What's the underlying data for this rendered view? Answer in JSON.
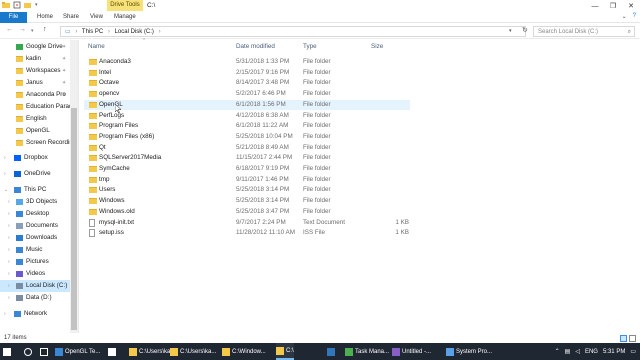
{
  "window": {
    "context_tab": "Drive Tools",
    "title": "C:\\",
    "controls": [
      "—",
      "❐",
      "✕"
    ]
  },
  "ribbon": {
    "tabs": [
      "File",
      "Home",
      "Share",
      "View",
      "Manage"
    ]
  },
  "address": {
    "crumbs": [
      "This PC",
      "›",
      "Local Disk (C:)",
      "›"
    ],
    "search_placeholder": "Search Local Disk (C:)"
  },
  "nav": {
    "items": [
      {
        "label": "Google Drive",
        "icon": "google-drive-icon",
        "pinned": true,
        "color": "#34a853"
      },
      {
        "label": "kadin",
        "icon": "folder-icon",
        "pinned": true,
        "color": "#f4c94b"
      },
      {
        "label": "Workspaces",
        "icon": "folder-icon",
        "pinned": true,
        "color": "#f4c94b"
      },
      {
        "label": "Janus",
        "icon": "folder-icon",
        "pinned": true,
        "color": "#f4c94b"
      },
      {
        "label": "Anaconda Pro",
        "icon": "folder-icon",
        "pinned": true,
        "color": "#f4c94b"
      },
      {
        "label": "Education Paradi",
        "icon": "folder-icon",
        "pinned": false,
        "color": "#f4c94b"
      },
      {
        "label": "English",
        "icon": "folder-icon",
        "pinned": false,
        "color": "#f4c94b"
      },
      {
        "label": "OpenGL",
        "icon": "folder-icon",
        "pinned": false,
        "color": "#f4c94b"
      },
      {
        "label": "Screen Recording",
        "icon": "folder-icon",
        "pinned": false,
        "color": "#f4c94b"
      },
      {
        "label": "Dropbox",
        "icon": "dropbox-icon",
        "pinned": false,
        "color": "#0061ff"
      },
      {
        "label": "OneDrive",
        "icon": "onedrive-icon",
        "pinned": false,
        "color": "#0a64d6"
      },
      {
        "label": "This PC",
        "icon": "pc-icon",
        "pinned": false,
        "color": "#3a87d8"
      },
      {
        "label": "3D Objects",
        "icon": "3d-objects-icon",
        "pinned": false,
        "color": "#56a8e8"
      },
      {
        "label": "Desktop",
        "icon": "desktop-icon",
        "pinned": false,
        "color": "#3a87d8"
      },
      {
        "label": "Documents",
        "icon": "documents-icon",
        "pinned": false,
        "color": "#8aa0b8"
      },
      {
        "label": "Downloads",
        "icon": "downloads-icon",
        "pinned": false,
        "color": "#2b7cd3"
      },
      {
        "label": "Music",
        "icon": "music-icon",
        "pinned": false,
        "color": "#3a87d8"
      },
      {
        "label": "Pictures",
        "icon": "pictures-icon",
        "pinned": false,
        "color": "#3a87d8"
      },
      {
        "label": "Videos",
        "icon": "videos-icon",
        "pinned": false,
        "color": "#6a5acd"
      },
      {
        "label": "Local Disk (C:)",
        "icon": "drive-icon",
        "pinned": false,
        "color": "#7a8da3"
      },
      {
        "label": "Data (D:)",
        "icon": "drive-icon",
        "pinned": false,
        "color": "#7a8da3"
      },
      {
        "label": "Network",
        "icon": "network-icon",
        "pinned": false,
        "color": "#3a87d8"
      }
    ]
  },
  "columns": {
    "name": "Name",
    "date": "Date modified",
    "type": "Type",
    "size": "Size"
  },
  "files": [
    {
      "name": "Anaconda3",
      "date": "5/31/2018 1:33 PM",
      "type": "File folder",
      "size": ""
    },
    {
      "name": "Intel",
      "date": "2/15/2017 9:16 PM",
      "type": "File folder",
      "size": ""
    },
    {
      "name": "Octave",
      "date": "8/14/2017 3:48 PM",
      "type": "File folder",
      "size": ""
    },
    {
      "name": "opencv",
      "date": "5/2/2017 6:46 PM",
      "type": "File folder",
      "size": ""
    },
    {
      "name": "OpenGL",
      "date": "6/1/2018 1:56 PM",
      "type": "File folder",
      "size": ""
    },
    {
      "name": "PerfLogs",
      "date": "4/12/2018 6:38 AM",
      "type": "File folder",
      "size": ""
    },
    {
      "name": "Program Files",
      "date": "6/1/2018 11:22 AM",
      "type": "File folder",
      "size": ""
    },
    {
      "name": "Program Files (x86)",
      "date": "5/25/2018 10:04 PM",
      "type": "File folder",
      "size": ""
    },
    {
      "name": "Qt",
      "date": "5/21/2018 8:49 AM",
      "type": "File folder",
      "size": ""
    },
    {
      "name": "SQLServer2017Media",
      "date": "11/15/2017 2:44 PM",
      "type": "File folder",
      "size": ""
    },
    {
      "name": "SymCache",
      "date": "6/18/2017 9:19 PM",
      "type": "File folder",
      "size": ""
    },
    {
      "name": "tmp",
      "date": "9/11/2017 1:46 PM",
      "type": "File folder",
      "size": ""
    },
    {
      "name": "Users",
      "date": "5/25/2018 3:14 PM",
      "type": "File folder",
      "size": ""
    },
    {
      "name": "Windows",
      "date": "5/25/2018 3:14 PM",
      "type": "File folder",
      "size": ""
    },
    {
      "name": "Windows.old",
      "date": "5/25/2018 3:47 PM",
      "type": "File folder",
      "size": ""
    },
    {
      "name": "mysql-init.txt",
      "date": "9/7/2017 2:24 PM",
      "type": "Text Document",
      "size": "1 KB"
    },
    {
      "name": "setup.iss",
      "date": "11/28/2012 11:10 AM",
      "type": "ISS File",
      "size": "1 KB"
    }
  ],
  "status": {
    "count": "17 items"
  },
  "taskbar": {
    "items": [
      {
        "label": "",
        "icon": "start-icon"
      },
      {
        "label": "",
        "icon": "cortana-icon"
      },
      {
        "label": "",
        "icon": "task-view-icon"
      },
      {
        "label": "OpenGL Te...",
        "icon": "app-icon"
      },
      {
        "label": "",
        "icon": "mail-icon"
      },
      {
        "label": "C:\\Users\\ka...",
        "icon": "folder-icon"
      },
      {
        "label": "C:\\Users\\ka...",
        "icon": "folder-icon"
      },
      {
        "label": "C:\\Window...",
        "icon": "folder-icon"
      },
      {
        "label": "C:\\",
        "icon": "folder-icon"
      },
      {
        "label": "",
        "icon": "edge-icon"
      },
      {
        "label": "Task Mana...",
        "icon": "task-manager-icon"
      },
      {
        "label": "Untitled -...",
        "icon": "visual-studio-icon"
      },
      {
        "label": "System Pro...",
        "icon": "system-icon"
      }
    ],
    "lang": "ENG",
    "time": "5:31 PM"
  },
  "colors": {
    "accent": "#1979ca",
    "selection": "#cce8ff",
    "hover": "#e5f3ff",
    "folder": "#f4c94b",
    "taskbar": "#1f2733"
  }
}
